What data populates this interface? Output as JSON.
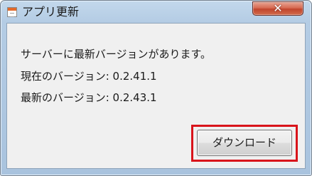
{
  "window": {
    "title": "アプリ更新",
    "close_glyph": "✕",
    "icons": {
      "app": "app-window-icon",
      "close": "close-icon"
    }
  },
  "dialog": {
    "messages": [
      "サーバーに最新バージョンがあります。",
      "現在のバージョン: 0.2.41.1",
      "最新のバージョン: 0.2.43.1"
    ],
    "download_label": "ダウンロード"
  },
  "colors": {
    "highlight": "#d9141b",
    "titlebar": "#b4cce4",
    "close_button": "#c1452d"
  }
}
